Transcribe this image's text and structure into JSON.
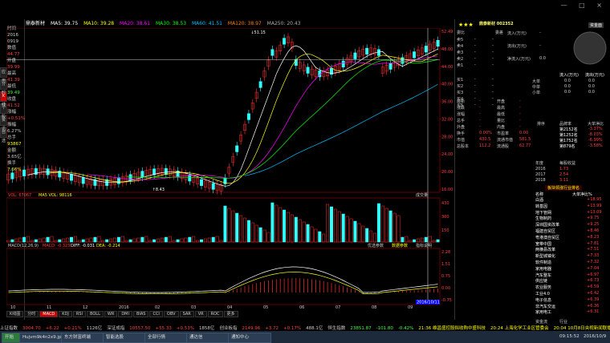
{
  "window": {
    "controls": "— □ ×"
  },
  "chart_header": {
    "name": "鼎泰新材",
    "ma5": "MA5: 39.75",
    "ma10": "MA10: 39.28",
    "ma20": "MA20: 38.61",
    "ma30": "MA30: 38.53",
    "ma60": "MA60: 41.51",
    "ma120": "MA120: 38.97",
    "ma250": "MA250: 20.43"
  },
  "left_panel": {
    "items": [
      {
        "label": "时间",
        "value": "2016"
      },
      {
        "label": "",
        "value": "0919"
      },
      {
        "label": "数值",
        "value": "44.77"
      },
      {
        "label": "开盘",
        "value": "39.99"
      },
      {
        "label": "最高",
        "value": "41.39"
      },
      {
        "label": "最低",
        "value": "39.49"
      },
      {
        "label": "收盘",
        "value": "41.52"
      },
      {
        "label": "涨幅",
        "value": "+0.51%"
      },
      {
        "label": "振幅",
        "value": "6.27%"
      },
      {
        "label": "总手",
        "value": "93867"
      },
      {
        "label": "金额",
        "value": "3.65亿"
      },
      {
        "label": "换手",
        "value": "7.66%"
      }
    ],
    "tabs": [
      "应用",
      "分时",
      "K线",
      "个股",
      "资讯",
      "自选"
    ]
  },
  "price_axis": [
    "52.49",
    "48.00",
    "44.00",
    "40.00",
    "36.00",
    "32.00",
    "28.00",
    "24.00",
    "20.00",
    "16.00"
  ],
  "high_label": "↓51.15",
  "low_label": "↑8.43",
  "vol_header": {
    "label": "成交量",
    "vol": "VOL: 67067",
    "ma5": "MA5 VOL: 98116"
  },
  "vol_axis": [
    "430",
    "300",
    "150"
  ],
  "macd_header": {
    "label": "MACD(12,26,9)",
    "macd": "MACD: -0.323",
    "diff": "DIFF: -0.031",
    "dea": "DEA: -0.214"
  },
  "macd_axis": [
    "2.28",
    "1.51",
    "0.75",
    "0.00",
    "-0.75"
  ],
  "macd_tags": [
    "优选参数",
    "数据参数",
    "指标说明"
  ],
  "cursor_date": "2016/10/11",
  "date_labels": [
    "10",
    "11",
    "12",
    "2016",
    "02",
    "03",
    "04",
    "05",
    "06",
    "07",
    "08",
    "09"
  ],
  "bottom_tabs": [
    "K线图",
    "分时",
    "MACD",
    "KDJ",
    "RSI",
    "BOLL",
    "WR",
    "DMI",
    "BIAS",
    "CCI",
    "OBV",
    "SAR",
    "VR",
    "ROC",
    "更多"
  ],
  "right_panel": {
    "stars": "★★★",
    "stock_name": "鼎泰新材 002352",
    "fund_label": "资金面",
    "weibi": "委比",
    "weicha": "委差",
    "asks": [
      {
        "label": "卖5",
        "price": "-",
        "vol": "-"
      },
      {
        "label": "卖4",
        "price": "-",
        "vol": "-"
      },
      {
        "label": "卖3",
        "price": "-",
        "vol": "-"
      },
      {
        "label": "卖2",
        "price": "-",
        "vol": "-"
      },
      {
        "label": "卖1",
        "price": "-",
        "vol": "-"
      }
    ],
    "bids": [
      {
        "label": "买1",
        "price": "-",
        "vol": "-"
      },
      {
        "label": "买2",
        "price": "-",
        "vol": "-"
      },
      {
        "label": "买3",
        "price": "-",
        "vol": "-"
      },
      {
        "label": "买4",
        "price": "-",
        "vol": "-"
      },
      {
        "label": "买5",
        "price": "-",
        "vol": "-"
      }
    ],
    "flow": [
      {
        "label": "流入(万元)",
        "value": "-"
      },
      {
        "label": "流出(万元)",
        "value": "-"
      },
      {
        "label": "净流入(万元)",
        "value": "0.0"
      }
    ],
    "order_sizes": [
      {
        "label": "大单",
        "in": "0.0",
        "out": "0.0"
      },
      {
        "label": "中单",
        "in": "0.0",
        "out": "0.0"
      },
      {
        "label": "小单",
        "in": "0.0",
        "out": "0.0"
      }
    ],
    "in_out_header": {
      "inflow": "流入(万元)",
      "outflow": "流出(万元)"
    },
    "stats": [
      {
        "l1": "最新",
        "v1": "-",
        "l2": "开盘",
        "v2": "-"
      },
      {
        "l1": "涨跌",
        "v1": "-",
        "l2": "最高",
        "v2": "-"
      },
      {
        "l1": "涨幅",
        "v1": "-",
        "l2": "最低",
        "v2": "-"
      },
      {
        "l1": "总手",
        "v1": "-",
        "l2": "量比",
        "v2": "-"
      },
      {
        "l1": "外盘",
        "v1": "-",
        "l2": "内盘",
        "v2": "-"
      },
      {
        "l1": "换手",
        "v1": "0.00%",
        "l2": "市盈率",
        "v2": "0.00"
      },
      {
        "l1": "市值",
        "v1": "430.5",
        "l2": "流通市值",
        "v2": "581.5"
      },
      {
        "l1": "总股本",
        "v1": "112.2",
        "l2": "流通股",
        "v2": "62.77"
      }
    ],
    "rank_header": {
      "a": "排序",
      "b": "品牌率",
      "c": "大单净比"
    },
    "ranks": [
      {
        "rank": "第2152名",
        "value": "-3.37%"
      },
      {
        "rank": "第1252名",
        "value": "-8.03%"
      },
      {
        "rank": "第1752名",
        "value": "-6.99%"
      },
      {
        "rank": "第879名",
        "value": "-3.58%"
      }
    ],
    "eps_header": {
      "a": "年度",
      "b": "每股收益"
    },
    "eps": [
      {
        "year": "2016",
        "value": "1.73"
      },
      {
        "year": "2017",
        "value": "2.54"
      },
      {
        "year": "2018",
        "value": "3.11"
      }
    ],
    "sector_title": "板块领涨行业排名",
    "sector_header": {
      "a": "名称",
      "b": "大单净比%"
    },
    "sectors": [
      {
        "name": "白酒",
        "value": "+18.95"
      },
      {
        "name": "转基因",
        "value": "+13.99"
      },
      {
        "name": "地下管网",
        "value": "+13.09"
      },
      {
        "name": "生物制药",
        "value": "+9.75"
      },
      {
        "name": "深圳国资改革",
        "value": "+9.25"
      },
      {
        "name": "福建自贸区",
        "value": "+8.46"
      },
      {
        "name": "粤港澳自贸区",
        "value": "+8.23"
      },
      {
        "name": "宽带中国",
        "value": "+7.81"
      },
      {
        "name": "两横县改革",
        "value": "+7.51"
      },
      {
        "name": "新型城镇化",
        "value": "+7.33"
      },
      {
        "name": "软件制造",
        "value": "+7.32"
      },
      {
        "name": "家用电器",
        "value": "+7.04"
      },
      {
        "name": "汽车整车",
        "value": "+6.97"
      },
      {
        "name": "供应链",
        "value": "+6.73"
      },
      {
        "name": "农业服务",
        "value": "+6.59"
      },
      {
        "name": "工业4.0",
        "value": "+6.42"
      },
      {
        "name": "电子信息",
        "value": "+6.39"
      },
      {
        "name": "非汽车交运",
        "value": "+6.36"
      },
      {
        "name": "家用电工",
        "value": "+6.31"
      }
    ],
    "tab_a": "资金流",
    "tab_b": "行业"
  },
  "ticker": [
    {
      "text": "上证指数",
      "color": "#ccc"
    },
    {
      "text": "3004.70",
      "color": "#ff4040"
    },
    {
      "text": "+6.22",
      "color": "#ff4040"
    },
    {
      "text": "+0.21%",
      "color": "#ff4040"
    },
    {
      "text": "1126亿",
      "color": "#ccc"
    },
    {
      "text": "深证成指",
      "color": "#ccc"
    },
    {
      "text": "10557.50",
      "color": "#ff4040"
    },
    {
      "text": "+55.33",
      "color": "#ff4040"
    },
    {
      "text": "+0.53%",
      "color": "#ff4040"
    },
    {
      "text": "1858亿",
      "color": "#ccc"
    },
    {
      "text": "创业板指",
      "color": "#ccc"
    },
    {
      "text": "2149.96",
      "color": "#ff4040"
    },
    {
      "text": "+3.72",
      "color": "#ff4040"
    },
    {
      "text": "+0.17%",
      "color": "#ff4040"
    },
    {
      "text": "488.1亿",
      "color": "#ccc"
    },
    {
      "text": "恒生指数",
      "color": "#ccc"
    },
    {
      "text": "23851.87",
      "color": "#3fff3f"
    },
    {
      "text": "-101.80",
      "color": "#3fff3f"
    },
    {
      "text": "-0.42%",
      "color": "#3fff3f"
    }
  ],
  "news": [
    "21:36 维昌盛控股拟收购中盛科技",
    "20:24 上海化学工业区管委会",
    "20:04 10月8日央视新闻联播"
  ],
  "taskbar": {
    "start": "开始",
    "items": [
      "Hujvm9k4n2x9.jp...",
      "东方财富终端",
      "智能选股",
      "全部行情",
      "通达信",
      "通知中心"
    ],
    "tray": "09:15:52",
    "date": "2016/10/9"
  }
}
